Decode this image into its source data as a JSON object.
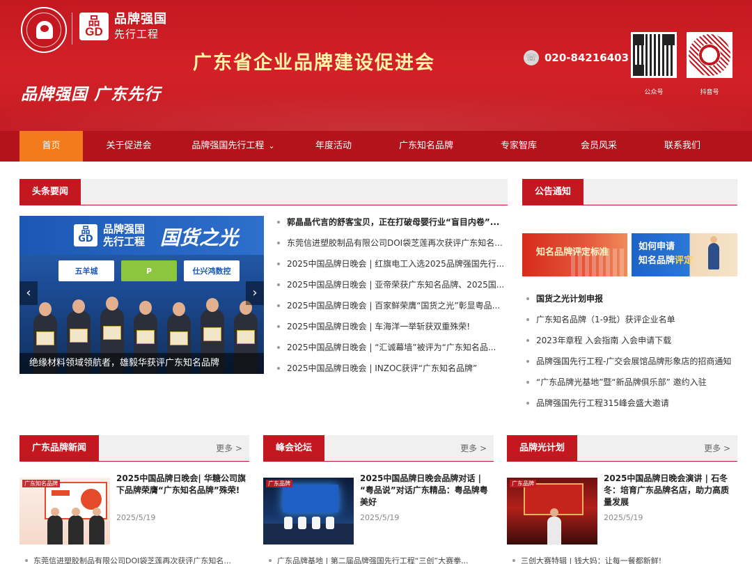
{
  "header": {
    "brand_line1": "品牌强国",
    "brand_line2": "先行工程",
    "gd_top": "品",
    "gd_bottom": "GD",
    "slogan": "品牌强国 广东先行",
    "site_title": "广东省企业品牌建设促进会",
    "phone_icon": "phone-icon",
    "phone": "020-84216403",
    "qr1_label": "公众号",
    "qr2_label": "抖音号"
  },
  "nav": {
    "items": [
      {
        "label": "首页",
        "active": true
      },
      {
        "label": "关于促进会"
      },
      {
        "label": "品牌强国先行工程",
        "has_dropdown": true,
        "caret": "⌄"
      },
      {
        "label": "年度活动"
      },
      {
        "label": "广东知名品牌"
      },
      {
        "label": "专家智库"
      },
      {
        "label": "会员风采"
      },
      {
        "label": "联系我们"
      }
    ]
  },
  "headline": {
    "title": "头条要闻",
    "slider": {
      "brand_top": "品牌强国",
      "brand_bottom": "先行工程",
      "gd_top": "品",
      "gd_bottom": "GD",
      "big_text": "国货之光",
      "sponsors": [
        "五羊城",
        "P",
        "仕兴鸿数控"
      ],
      "caption": "绝缘材料领域领航者，雄毅华获评广东知名品牌",
      "prev": "‹",
      "next": "›"
    },
    "news": [
      "郭晶晶代言的舒客宝贝，正在打破母婴行业“盲目内卷”...",
      "东莞信进塑胶制品有限公司DOI袋芝莲再次获评广东知名...",
      "2025中国品牌日晚会 | 红旗电工入选2025品牌强国先行...",
      "2025中国品牌日晚会 | 亚帝荣获广东知名品牌、2025国...",
      "2025中国品牌日晚会 | 百家鲜荣膺“国货之光”彰显粤品...",
      "2025中国品牌日晚会 | 车海洋一举斩获双重殊荣!",
      "2025中国品牌日晚会 | “汇诚幕墙”被评为“广东知名品...",
      "2025中国品牌日晚会 | INZOC获评“广东知名品牌”"
    ]
  },
  "notice": {
    "title": "公告通知",
    "banner1": "知名品牌评定标准",
    "banner2_line1": "如何申请",
    "banner2_line2a": "知名品牌",
    "banner2_line2b": "评定",
    "items": [
      "国货之光计划申报",
      "广东知名品牌（1-9批）获评企业名单",
      "2023年章程 入会指南 入会申请下载",
      "品牌强国先行工程-广交会展馆品牌形象店的招商通知",
      "“广东品牌光基地”暨“新品牌俱乐部” 邀约入驻",
      "品牌强国先行工程315峰会盛大邀请"
    ]
  },
  "columns": [
    {
      "title": "广东品牌新闻",
      "more": "更多 >",
      "img_tag": "广东知名品牌",
      "card_title": "2025中国品牌日晚会| 华糖公司旗下品牌荣膺“广东知名品牌”殊荣!",
      "date": "2025/5/19",
      "line": "东莞信进塑胶制品有限公司DOI袋芝莲再次获评广东知名..."
    },
    {
      "title": "峰会论坛",
      "more": "更多 >",
      "img_tag": "广东品牌",
      "card_title": "2025中国品牌日晚会品牌对话 | “粤品说”对话广东精品：粤品牌粤美好",
      "date": "2025/5/19",
      "line": "广东品牌基地 | 第二届品牌强国先行工程“三创”大赛拳..."
    },
    {
      "title": "品牌光计划",
      "more": "更多 >",
      "img_tag": "广东品牌",
      "card_title": "2025中国品牌日晚会演讲 | 石冬冬：培育广东品牌名店，助力高质量发展",
      "date": "2025/5/19",
      "line": "三创大赛特辑 | 钱大妈：让每一餐都新鲜!"
    }
  ]
}
